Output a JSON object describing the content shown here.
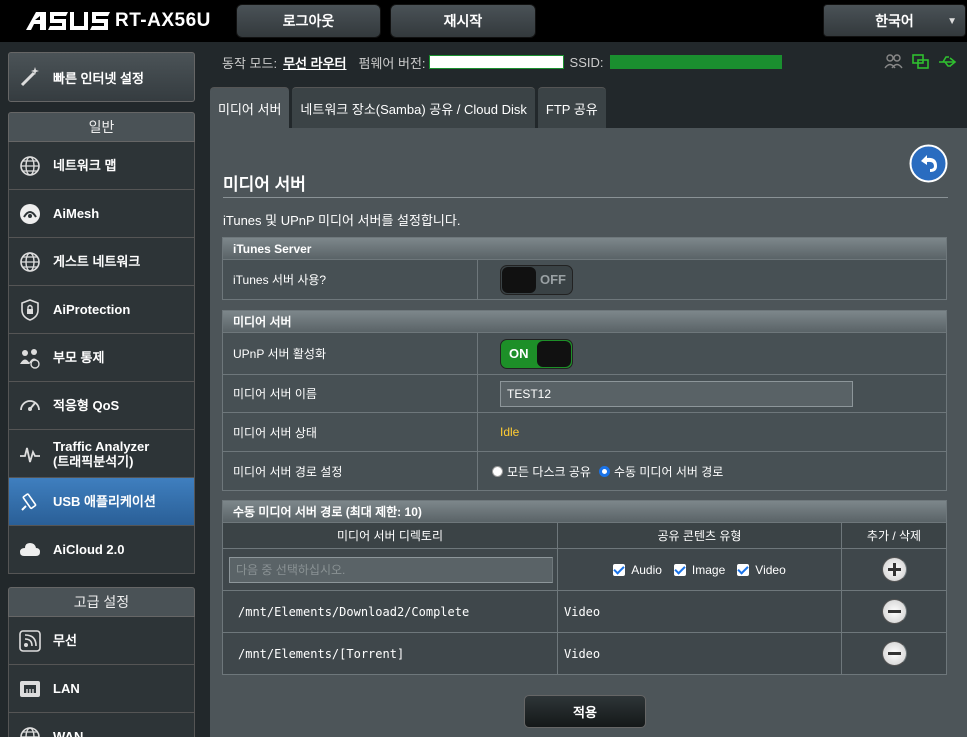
{
  "header": {
    "brand": "/ISUS",
    "model": "RT-AX56U",
    "logout_label": "로그아웃",
    "reboot_label": "재시작",
    "language": "한국어"
  },
  "status": {
    "op_mode_label": "동작 모드:",
    "op_mode_value": "무선 라우터",
    "firmware_label": "펌웨어 버전:",
    "ssid_label": "SSID:"
  },
  "sidebar": {
    "quick_setup": "빠른 인터넷 설정",
    "general_title": "일반",
    "general_items": [
      {
        "label": "네트워크 맵",
        "icon": "globe-icon"
      },
      {
        "label": "AiMesh",
        "icon": "aimesh-icon"
      },
      {
        "label": "게스트 네트워크",
        "icon": "globe-icon"
      },
      {
        "label": "AiProtection",
        "icon": "lock-shield-icon"
      },
      {
        "label": "부모 통제",
        "icon": "family-icon"
      },
      {
        "label": "적응형 QoS",
        "icon": "gauge-icon"
      },
      {
        "label": "Traffic Analyzer",
        "label2": "(트래픽분석기)",
        "icon": "pulse-icon"
      },
      {
        "label": "USB 애플리케이션",
        "icon": "usb-icon",
        "active": true
      },
      {
        "label": "AiCloud 2.0",
        "icon": "cloud-icon"
      }
    ],
    "advanced_title": "고급 설정",
    "advanced_items": [
      {
        "label": "무선",
        "icon": "wifi-icon"
      },
      {
        "label": "LAN",
        "icon": "lan-icon"
      },
      {
        "label": "WAN",
        "icon": "globe-icon"
      }
    ]
  },
  "tabs": [
    {
      "label": "미디어 서버",
      "active": true
    },
    {
      "label": "네트워크 장소(Samba) 공유 / Cloud Disk",
      "active": false
    },
    {
      "label": "FTP 공유",
      "active": false
    }
  ],
  "page": {
    "title": "미디어 서버",
    "description": "iTunes 및 UPnP 미디어 서버를 설정합니다."
  },
  "itunes": {
    "header": "iTunes Server",
    "enable_label": "iTunes 서버 사용?",
    "toggle_text": "OFF"
  },
  "media": {
    "header": "미디어 서버",
    "upnp_label": "UPnP 서버 활성화",
    "upnp_toggle_text": "ON",
    "name_label": "미디어 서버 이름",
    "name_value": "TEST12",
    "state_label": "미디어 서버 상태",
    "state_value": "Idle",
    "path_label": "미디어 서버 경로 설정",
    "path_opt_all": "모든 다스크 공유",
    "path_opt_manual": "수동 미디어 서버 경로"
  },
  "manual": {
    "header": "수동 미디어 서버 경로 (최대 제한: 10)",
    "col_dir": "미디어 서버 디렉토리",
    "col_type": "공유 콘텐츠 유형",
    "col_action": "추가 / 삭제",
    "dir_placeholder": "다음 중 선택하십시오.",
    "check_audio": "Audio",
    "check_image": "Image",
    "check_video": "Video",
    "rows": [
      {
        "path": "/mnt/Elements/Download2/Complete",
        "type": "Video"
      },
      {
        "path": "/mnt/Elements/[Torrent]",
        "type": "Video"
      }
    ]
  },
  "apply_label": "적용"
}
